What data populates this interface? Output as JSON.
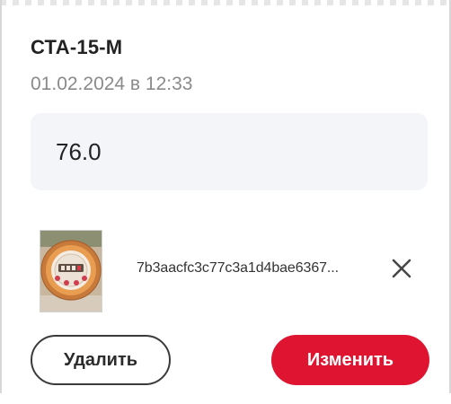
{
  "reading_card": {
    "device_name": "СТА-15-М",
    "date": "01.02.2024 в 12:33",
    "value": "76.0",
    "attachment": {
      "file_name": "7b3aacfc3c77c3a1d4bae6367...",
      "thumbnail_icon": "water-meter-photo",
      "remove_icon": "close-icon"
    },
    "actions": {
      "delete_label": "Удалить",
      "edit_label": "Изменить"
    }
  },
  "colors": {
    "accent": "#df1430",
    "input_background": "#f3f5f9",
    "secondary_text": "#8a8a8a"
  }
}
